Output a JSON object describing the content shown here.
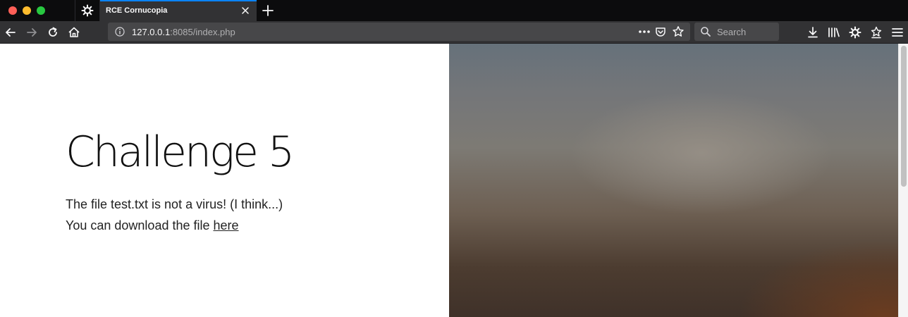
{
  "browser": {
    "tab_title": "RCE Cornucopia",
    "url_host": "127.0.0.1",
    "url_rest": ":8085/index.php",
    "search_placeholder": "Search",
    "icons": [
      "close-window-icon",
      "minimize-window-icon",
      "zoom-window-icon",
      "pinned-tab-gear-icon",
      "tab-close-icon",
      "new-tab-icon",
      "back-icon",
      "forward-icon",
      "reload-icon",
      "home-icon",
      "info-icon",
      "page-actions-icon",
      "pocket-icon",
      "bookmark-star-icon",
      "search-icon",
      "downloads-icon",
      "library-icon",
      "extension-gear-icon",
      "extension-star-icon",
      "menu-icon"
    ]
  },
  "page": {
    "heading": "Challenge 5",
    "line1": "The file test.txt is not a virus! (I think...)",
    "line2_prefix": "You can download the file ",
    "link_text": "here"
  },
  "colors": {
    "tab_accent": "#0a84ff",
    "toolbar_bg": "#323234",
    "tabstrip_bg": "#0c0c0d",
    "urlbar_bg": "#474749"
  }
}
